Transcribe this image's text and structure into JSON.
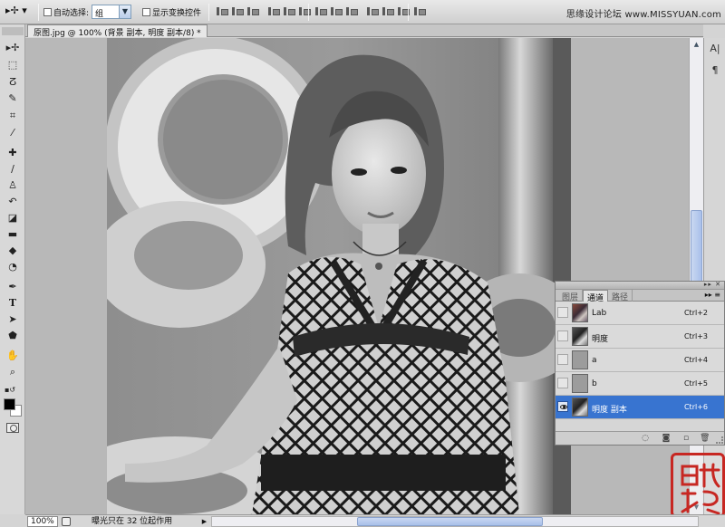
{
  "options_bar": {
    "auto_select_label": "自动选择:",
    "auto_select_value": "组",
    "show_transform_label": "显示变换控件",
    "watermark": "思缘设计论坛 www.MISSYUAN.com"
  },
  "document": {
    "tab_title": "原图.jpg @ 100% (背景 副本, 明度 副本/8) *"
  },
  "toolbox": {
    "tools": [
      "move-icon",
      "marquee-icon",
      "lasso-icon",
      "quick-select-icon",
      "crop-icon",
      "eyedropper-icon",
      "healing-brush-icon",
      "brush-icon",
      "clone-stamp-icon",
      "history-brush-icon",
      "eraser-icon",
      "gradient-icon",
      "blur-icon",
      "dodge-icon",
      "pen-icon",
      "type-icon",
      "path-select-icon",
      "shape-icon",
      "hand-icon",
      "zoom-icon"
    ],
    "type_glyph": "T"
  },
  "mini_panel": {
    "char_glyph": "A|",
    "para_glyph": "¶"
  },
  "status_bar": {
    "zoom": "100%",
    "message": "曝光只在 32 位起作用"
  },
  "channels_panel": {
    "tabs": [
      {
        "label": "图层",
        "active": false
      },
      {
        "label": "通道",
        "active": true
      },
      {
        "label": "路径",
        "active": false
      }
    ],
    "channels": [
      {
        "name": "Lab",
        "shortcut": "Ctrl+2",
        "thumb": "color",
        "visible": false,
        "selected": false
      },
      {
        "name": "明度",
        "shortcut": "Ctrl+3",
        "thumb": "gray",
        "visible": false,
        "selected": false
      },
      {
        "name": "a",
        "shortcut": "Ctrl+4",
        "thumb": "flat",
        "visible": false,
        "selected": false
      },
      {
        "name": "b",
        "shortcut": "Ctrl+5",
        "thumb": "flat",
        "visible": false,
        "selected": false
      },
      {
        "name": "明度 副本",
        "shortcut": "Ctrl+6",
        "thumb": "gray",
        "visible": true,
        "selected": true
      }
    ]
  },
  "colors": {
    "selection": "#3874d0",
    "seal": "#c72722"
  }
}
